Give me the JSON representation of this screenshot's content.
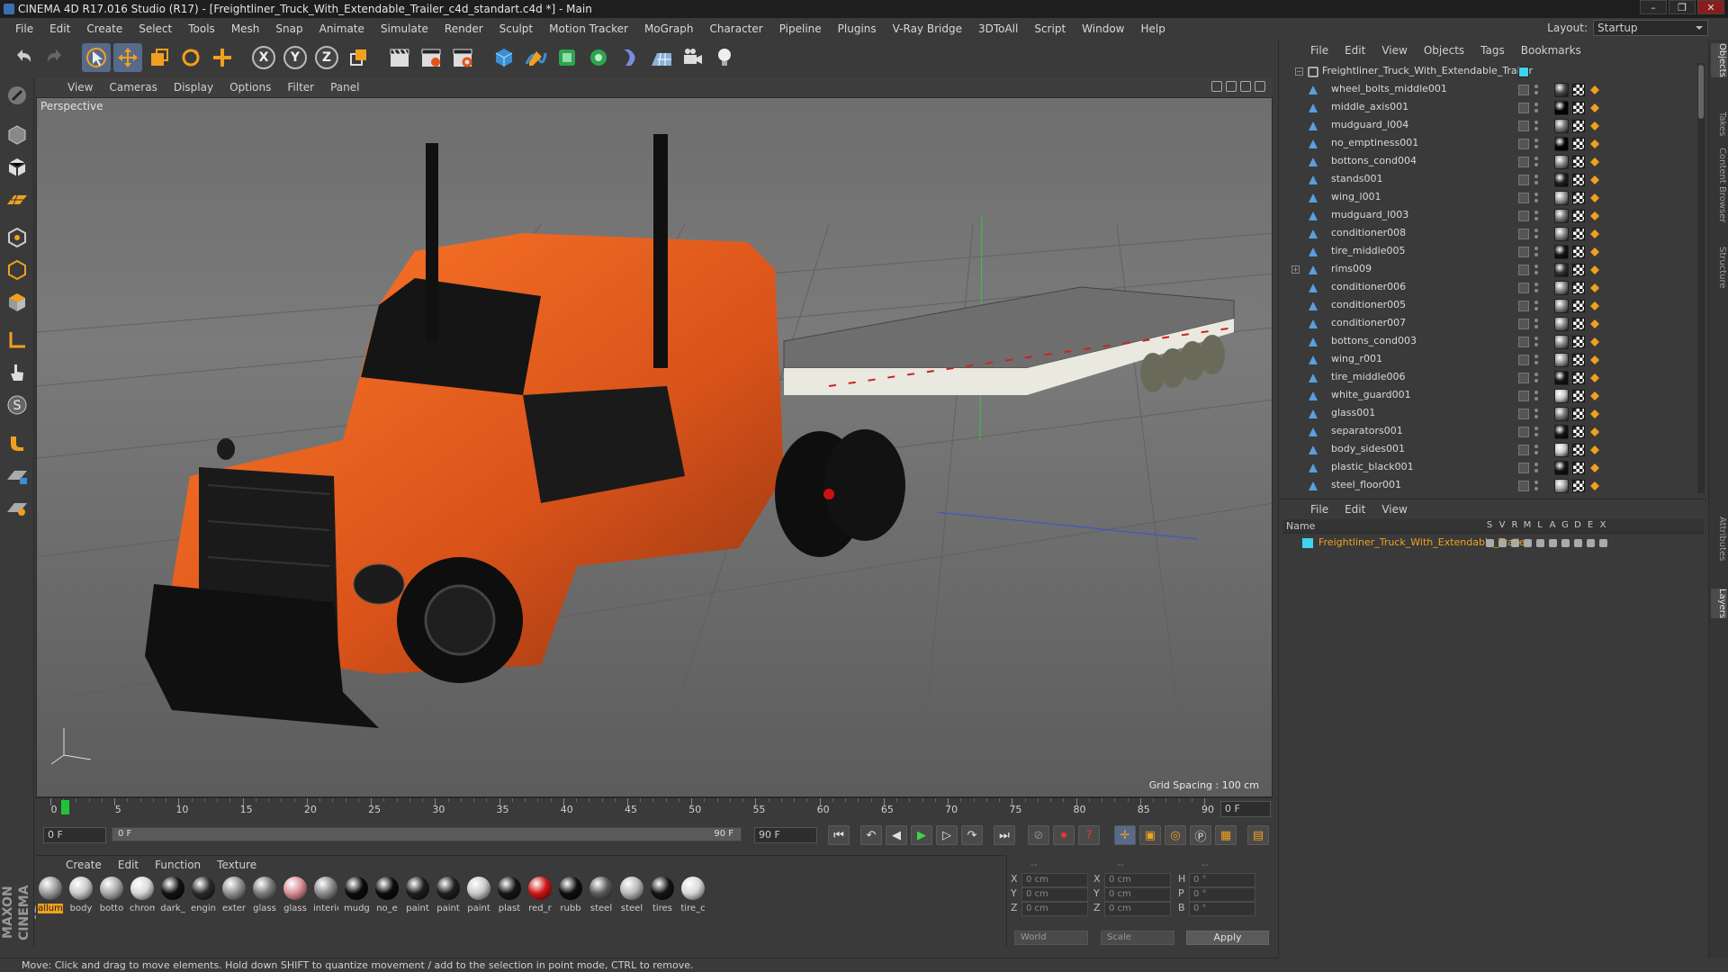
{
  "window": {
    "title": "CINEMA 4D R17.016 Studio (R17) - [Freightliner_Truck_With_Extendable_Trailer_c4d_standart.c4d *] - Main",
    "controls": [
      "–",
      "❐",
      "✕"
    ]
  },
  "menubar": {
    "items": [
      "File",
      "Edit",
      "Create",
      "Select",
      "Tools",
      "Mesh",
      "Snap",
      "Animate",
      "Simulate",
      "Render",
      "Sculpt",
      "Motion Tracker",
      "MoGraph",
      "Character",
      "Pipeline",
      "Plugins",
      "V-Ray Bridge",
      "3DToAll",
      "Script",
      "Window",
      "Help"
    ],
    "layout_label": "Layout:",
    "layout_value": "Startup"
  },
  "viewport": {
    "menu": [
      "View",
      "Cameras",
      "Display",
      "Options",
      "Filter",
      "Panel"
    ],
    "camera_label": "Perspective",
    "grid_spacing": "Grid Spacing : 100 cm"
  },
  "timeline": {
    "ticks": [
      "0",
      "5",
      "10",
      "15",
      "20",
      "25",
      "30",
      "35",
      "40",
      "45",
      "50",
      "55",
      "60",
      "65",
      "70",
      "75",
      "80",
      "85",
      "90"
    ],
    "current_frame": "0 F"
  },
  "transport": {
    "start_field": "0 F",
    "range_start": "0 F",
    "range_end": "90 F",
    "end_field": "90 F"
  },
  "material_manager": {
    "menu": [
      "Create",
      "Edit",
      "Function",
      "Texture"
    ],
    "materials": [
      {
        "name": "allum",
        "color": "#9a9a9a",
        "selected": true
      },
      {
        "name": "body",
        "color": "#c9c9c9"
      },
      {
        "name": "botto",
        "color": "#a8a8a8"
      },
      {
        "name": "chrom",
        "color": "#d8d8d8"
      },
      {
        "name": "dark_",
        "color": "#111111"
      },
      {
        "name": "engin",
        "color": "#2a2a2a"
      },
      {
        "name": "exter",
        "color": "#8f8f8f"
      },
      {
        "name": "glass",
        "color": "#7a7a7a"
      },
      {
        "name": "glass",
        "color": "#d88e95"
      },
      {
        "name": "interio",
        "color": "#8a8a8a"
      },
      {
        "name": "mudg",
        "color": "#0c0c0c"
      },
      {
        "name": "no_e",
        "color": "#0c0c0c"
      },
      {
        "name": "paint",
        "color": "#1e1e1e"
      },
      {
        "name": "paint",
        "color": "#1e1e1e"
      },
      {
        "name": "paint",
        "color": "#c8c8c8"
      },
      {
        "name": "plast",
        "color": "#151515"
      },
      {
        "name": "red_r",
        "color": "#d01414"
      },
      {
        "name": "rubb",
        "color": "#0e0e0e"
      },
      {
        "name": "steel",
        "color": "#5a5a5a"
      },
      {
        "name": "steel",
        "color": "#b8b8b8"
      },
      {
        "name": "tires",
        "color": "#141414"
      },
      {
        "name": "tire_c",
        "color": "#d8d8d8"
      }
    ]
  },
  "coordinates": {
    "rows": [
      {
        "a": "X",
        "av": "0 cm",
        "b": "X",
        "bv": "0 cm",
        "c": "H",
        "cv": "0 °"
      },
      {
        "a": "Y",
        "av": "0 cm",
        "b": "Y",
        "bv": "0 cm",
        "c": "P",
        "cv": "0 °"
      },
      {
        "a": "Z",
        "av": "0 cm",
        "b": "Z",
        "bv": "0 cm",
        "c": "B",
        "cv": "0 °"
      }
    ],
    "world": "World",
    "scale": "Scale",
    "apply": "Apply",
    "header_dashes": [
      "--",
      "--",
      "--"
    ]
  },
  "status": "Move: Click and drag to move elements. Hold down SHIFT to quantize movement / add to the selection in point mode, CTRL to remove.",
  "object_manager": {
    "menu": [
      "File",
      "Edit",
      "View",
      "Objects",
      "Tags",
      "Bookmarks"
    ],
    "root": "Freightliner_Truck_With_Extendable_Trailer",
    "objects": [
      {
        "name": "wheel_bolts_middle001",
        "thumb": "#4a4a4a"
      },
      {
        "name": "middle_axis001",
        "thumb": "#050505"
      },
      {
        "name": "mudguard_l004",
        "thumb": "#7a7a7a"
      },
      {
        "name": "no_emptiness001",
        "thumb": "#050505"
      },
      {
        "name": "bottons_cond004",
        "thumb": "#8a8a8a"
      },
      {
        "name": "stands001",
        "thumb": "#202020"
      },
      {
        "name": "wing_l001",
        "thumb": "#9a9a9a"
      },
      {
        "name": "mudguard_l003",
        "thumb": "#7a7a7a"
      },
      {
        "name": "conditioner008",
        "thumb": "#8a8a8a"
      },
      {
        "name": "tire_middle005",
        "thumb": "#151515"
      },
      {
        "name": "rims009",
        "thumb": "#333333",
        "expandable": true
      },
      {
        "name": "conditioner006",
        "thumb": "#8a8a8a"
      },
      {
        "name": "conditioner005",
        "thumb": "#8a8a8a"
      },
      {
        "name": "conditioner007",
        "thumb": "#8a8a8a"
      },
      {
        "name": "bottons_cond003",
        "thumb": "#8a8a8a"
      },
      {
        "name": "wing_r001",
        "thumb": "#9a9a9a"
      },
      {
        "name": "tire_middle006",
        "thumb": "#151515"
      },
      {
        "name": "white_guard001",
        "thumb": "#c8c8c8"
      },
      {
        "name": "glass001",
        "thumb": "#7a7a7a"
      },
      {
        "name": "separators001",
        "thumb": "#151515"
      },
      {
        "name": "body_sides001",
        "thumb": "#c9c9c9"
      },
      {
        "name": "plastic_black001",
        "thumb": "#151515"
      },
      {
        "name": "steel_floor001",
        "thumb": "#aaaaaa"
      }
    ]
  },
  "layer_manager": {
    "menu": [
      "File",
      "Edit",
      "View"
    ],
    "header_name": "Name",
    "header_cols": [
      "S",
      "V",
      "R",
      "M",
      "L",
      "A",
      "G",
      "D",
      "E",
      "X"
    ],
    "layer_name": "Freightliner_Truck_With_Extendable_Trailer",
    "layer_color": "#3fd3f0"
  },
  "side_tabs": [
    "Objects",
    "Takes",
    "Content Browser",
    "Structure",
    "Attributes",
    "Layers"
  ],
  "colors": {
    "accent": "#f0a01e",
    "truck_orange": "#e2541a",
    "playhead": "#22c33a"
  }
}
